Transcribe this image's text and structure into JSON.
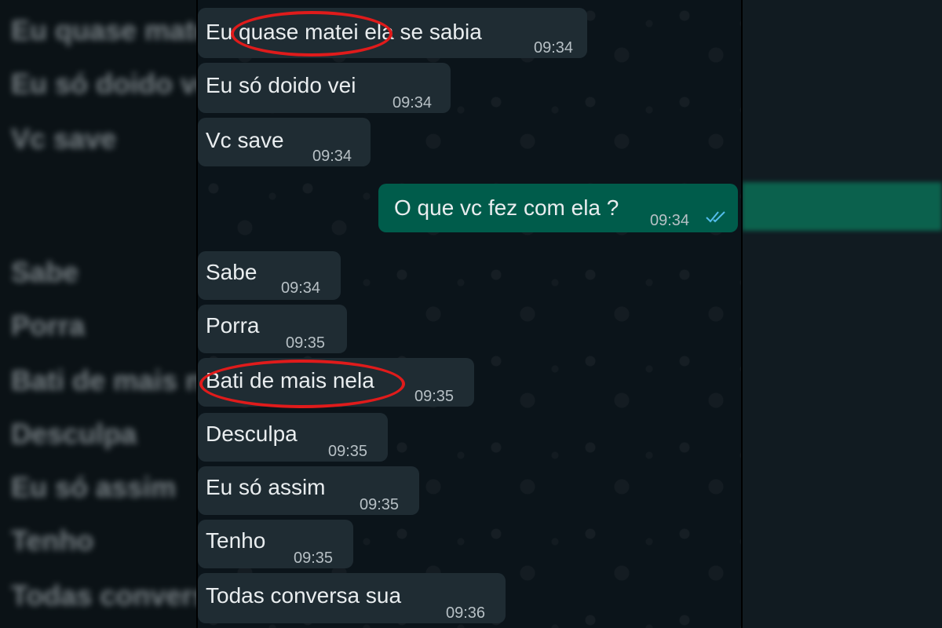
{
  "chat": {
    "messages": [
      {
        "direction": "in",
        "text": "Eu quase matei ela se sabia",
        "time": "09:34"
      },
      {
        "direction": "in",
        "text": "Eu só doido vei",
        "time": "09:34"
      },
      {
        "direction": "in",
        "text": "Vc save",
        "time": "09:34"
      },
      {
        "direction": "out",
        "text": "O que vc fez com ela ?",
        "time": "09:34",
        "status": "read"
      },
      {
        "direction": "in",
        "text": "Sabe",
        "time": "09:34"
      },
      {
        "direction": "in",
        "text": "Porra",
        "time": "09:35"
      },
      {
        "direction": "in",
        "text": "Bati de mais nela",
        "time": "09:35"
      },
      {
        "direction": "in",
        "text": "Desculpa",
        "time": "09:35"
      },
      {
        "direction": "in",
        "text": "Eu só assim",
        "time": "09:35"
      },
      {
        "direction": "in",
        "text": "Tenho",
        "time": "09:35"
      },
      {
        "direction": "in",
        "text": "Todas conversa sua",
        "time": "09:36"
      }
    ]
  },
  "colors": {
    "chat_background": "#0b141a",
    "incoming_bubble": "#1f2c33",
    "outgoing_bubble": "#005c4b",
    "read_ticks": "#53bdeb",
    "highlight_circle": "#e01b1b"
  },
  "annotations": [
    "quase matei",
    "Bati de mais nela"
  ]
}
